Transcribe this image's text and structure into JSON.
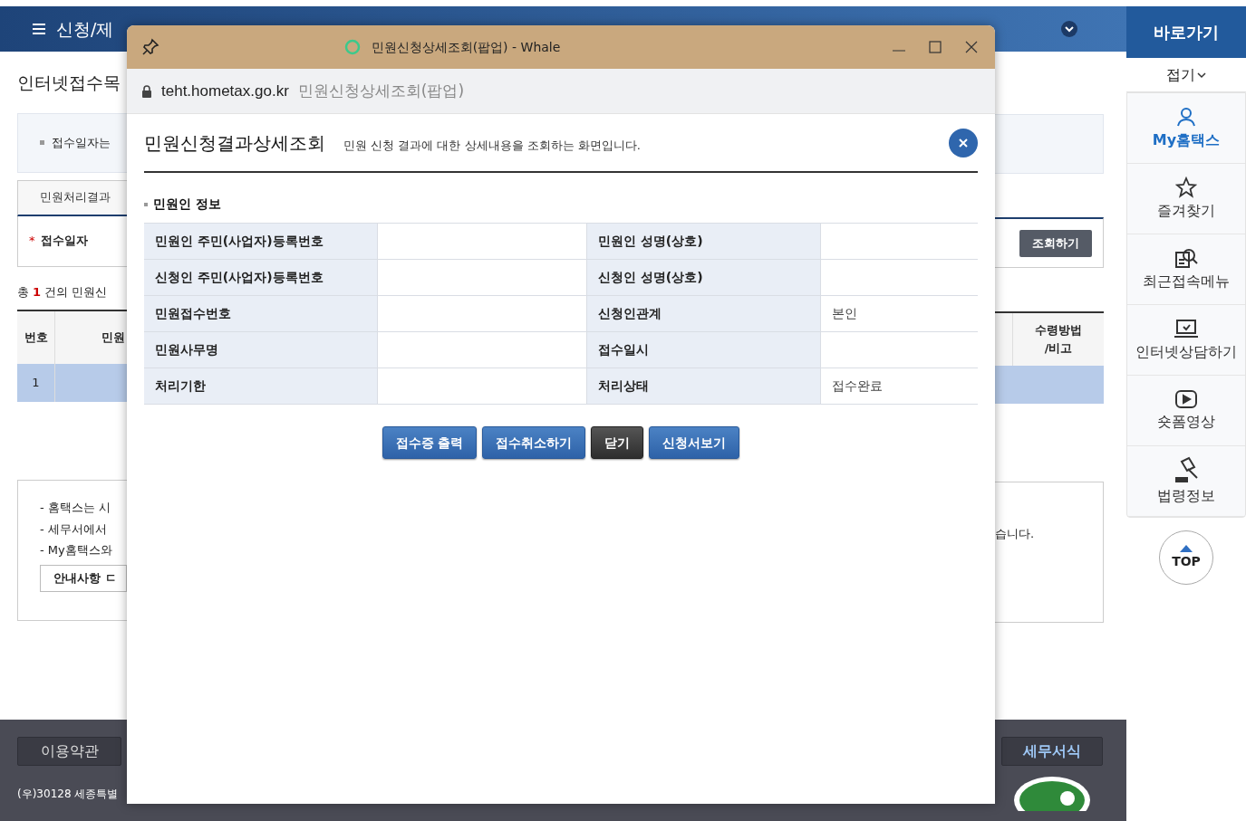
{
  "top_bar": {
    "title": "신청/제"
  },
  "page": {
    "title": "인터넷접수목",
    "info": "접수일자는",
    "tab": {
      "label": "민원처리결과",
      "selected": true
    },
    "search_label": "접수일자",
    "required_mark": "*",
    "search_button": "조회하기",
    "count": {
      "prefix": "총",
      "number": "1",
      "suffix": "건의 민원신"
    },
    "table": {
      "columns": [
        "번호",
        "민원"
      ],
      "last_column": "수령방법\n/비고",
      "rows": [
        {
          "number": "1",
          "selected": true
        }
      ]
    },
    "notes": [
      "- 홈택스는 시",
      "- 세무서에서",
      "- My홈택스와"
    ],
    "notes_tail": "습니다.",
    "notes_button": "안내사항 ㄷ"
  },
  "footer": {
    "left_button": "이용약관",
    "right_button": "세무서식",
    "address": "(우)30128 세종특별"
  },
  "quick_menu": {
    "title": "바로가기",
    "collapse": "접기",
    "items": [
      {
        "kind": "user",
        "label": "My홈택스",
        "selected": true
      },
      {
        "kind": "star",
        "label": "즐겨찾기",
        "selected": false
      },
      {
        "kind": "recent",
        "label": "최근접속메뉴",
        "selected": false
      },
      {
        "kind": "laptop",
        "label": "인터넷상담하기",
        "selected": false
      },
      {
        "kind": "play",
        "label": "숏폼영상",
        "selected": false
      },
      {
        "kind": "gavel",
        "label": "법령정보",
        "selected": false
      }
    ],
    "top": "TOP"
  },
  "popup": {
    "window_title": "민원신청상세조회(팝업) - Whale",
    "url": "teht.hometax.go.kr",
    "page_title": "민원신청상세조회(팝업)",
    "heading": "민원신청결과상세조회",
    "description": "민원 신청 결과에 대한 상세내용을 조회하는 화면입니다.",
    "section": "민원인 정보",
    "rows": [
      {
        "label_1": "민원인 주민(사업자)등록번호",
        "label_2": "민원인 성명(상호)"
      },
      {
        "label_1": "신청인 주민(사업자)등록번호",
        "label_2": "신청인 성명(상호)"
      },
      {
        "label_1": "민원접수번호",
        "label_2": "신청인관계",
        "value_2": "본인"
      },
      {
        "label_1": "민원사무명",
        "label_2": "접수일시"
      },
      {
        "label_1": "처리기한",
        "label_2": "처리상태",
        "value_2": "접수완료"
      }
    ],
    "buttons": [
      {
        "label": "접수증 출력",
        "kind": "primary"
      },
      {
        "label": "접수취소하기",
        "kind": "primary"
      },
      {
        "label": "닫기",
        "kind": "dark"
      },
      {
        "label": "신청서보기",
        "kind": "primary"
      }
    ]
  }
}
